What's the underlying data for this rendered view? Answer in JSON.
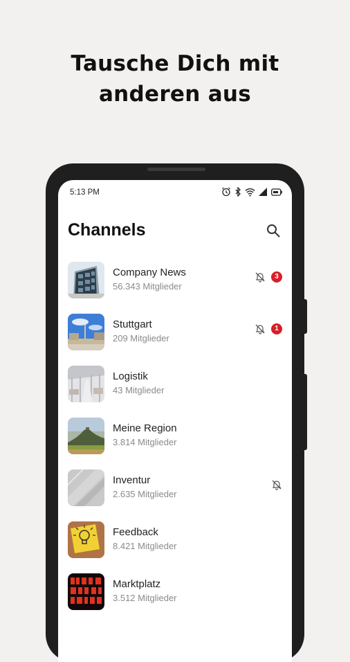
{
  "headline": {
    "line1": "Tausche Dich mit",
    "line2": "anderen aus"
  },
  "status_bar": {
    "time": "5:13 PM",
    "icons": [
      "alarm-icon",
      "bluetooth-icon",
      "wifi-icon",
      "signal-icon",
      "battery-icon"
    ]
  },
  "app_bar": {
    "title": "Channels",
    "search_icon": "search-icon"
  },
  "colors": {
    "badge": "#d71f2a",
    "background": "#f3f1ef",
    "phone_frame": "#1f1f1f"
  },
  "channels": [
    {
      "name": "Company News",
      "members": "56.343 Mitglieder",
      "muted": true,
      "badge": "3",
      "thumbnail": "office-building"
    },
    {
      "name": "Stuttgart",
      "members": "209 Mitglieder",
      "muted": true,
      "badge": "1",
      "thumbnail": "city-square"
    },
    {
      "name": "Logistik",
      "members": "43 Mitglieder",
      "muted": false,
      "badge": "",
      "thumbnail": "warehouse"
    },
    {
      "name": "Meine Region",
      "members": "3.814 Mitglieder",
      "muted": false,
      "badge": "",
      "thumbnail": "hill-landscape"
    },
    {
      "name": "Inventur",
      "members": "2.635 Mitglieder",
      "muted": true,
      "badge": "",
      "thumbnail": "concrete-texture"
    },
    {
      "name": "Feedback",
      "members": "8.421 Mitglieder",
      "muted": false,
      "badge": "",
      "thumbnail": "lightbulb-note"
    },
    {
      "name": "Marktplatz",
      "members": "3.512 Mitglieder",
      "muted": false,
      "badge": "",
      "thumbnail": "neon-sign"
    }
  ]
}
